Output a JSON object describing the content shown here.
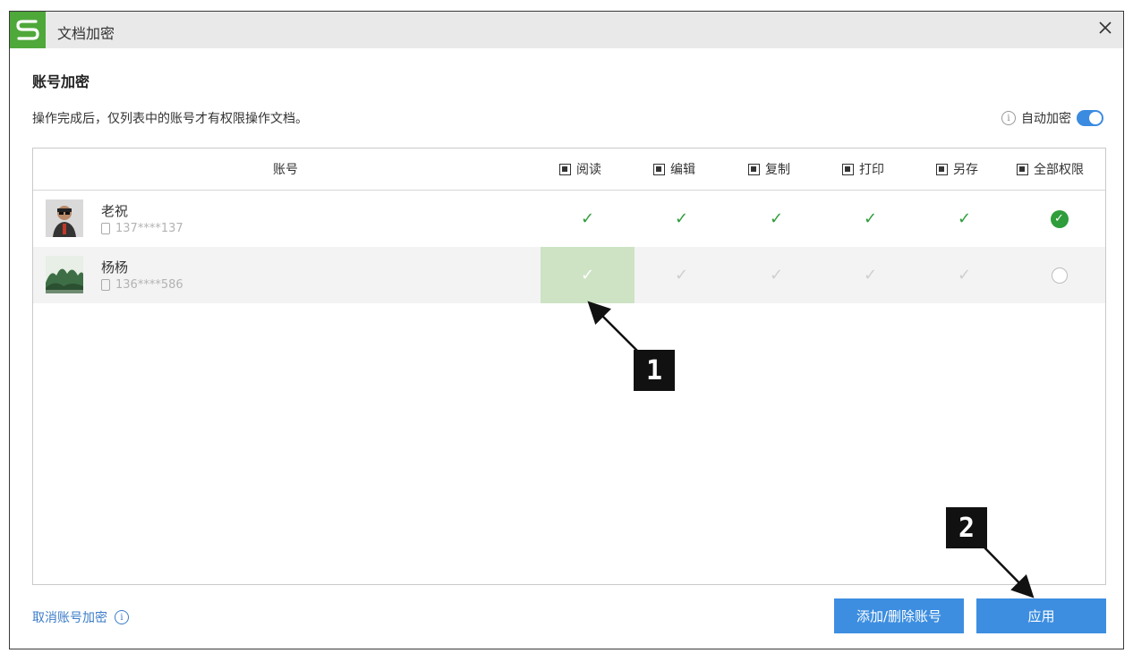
{
  "window": {
    "title": "文档加密",
    "close_glyph": "✕"
  },
  "section": {
    "title": "账号加密",
    "description": "操作完成后，仅列表中的账号才有权限操作文档。",
    "auto_encrypt_label": "自动加密",
    "auto_encrypt_on": true,
    "info_glyph": "i"
  },
  "table": {
    "columns": {
      "account": "账号",
      "read": "阅读",
      "edit": "编辑",
      "copy": "复制",
      "print": "打印",
      "save_as": "另存",
      "all": "全部权限"
    },
    "rows": [
      {
        "name": "老祝",
        "phone": "137****137",
        "read": true,
        "edit": true,
        "copy": true,
        "print": true,
        "save_as": true,
        "all": true
      },
      {
        "name": "杨杨",
        "phone": "136****586",
        "read": true,
        "edit": false,
        "copy": false,
        "print": false,
        "save_as": false,
        "all": false
      }
    ],
    "check_glyph": "✓"
  },
  "footer": {
    "cancel_link": "取消账号加密",
    "add_remove_button": "添加/删除账号",
    "apply_button": "应用"
  },
  "annotations": {
    "marker_1": "1",
    "marker_2": "2"
  },
  "colors": {
    "logo_green": "#4fa83a",
    "check_green": "#2e9d3a",
    "button_blue": "#3d8ee0",
    "highlight_green": "#cde3c4"
  }
}
